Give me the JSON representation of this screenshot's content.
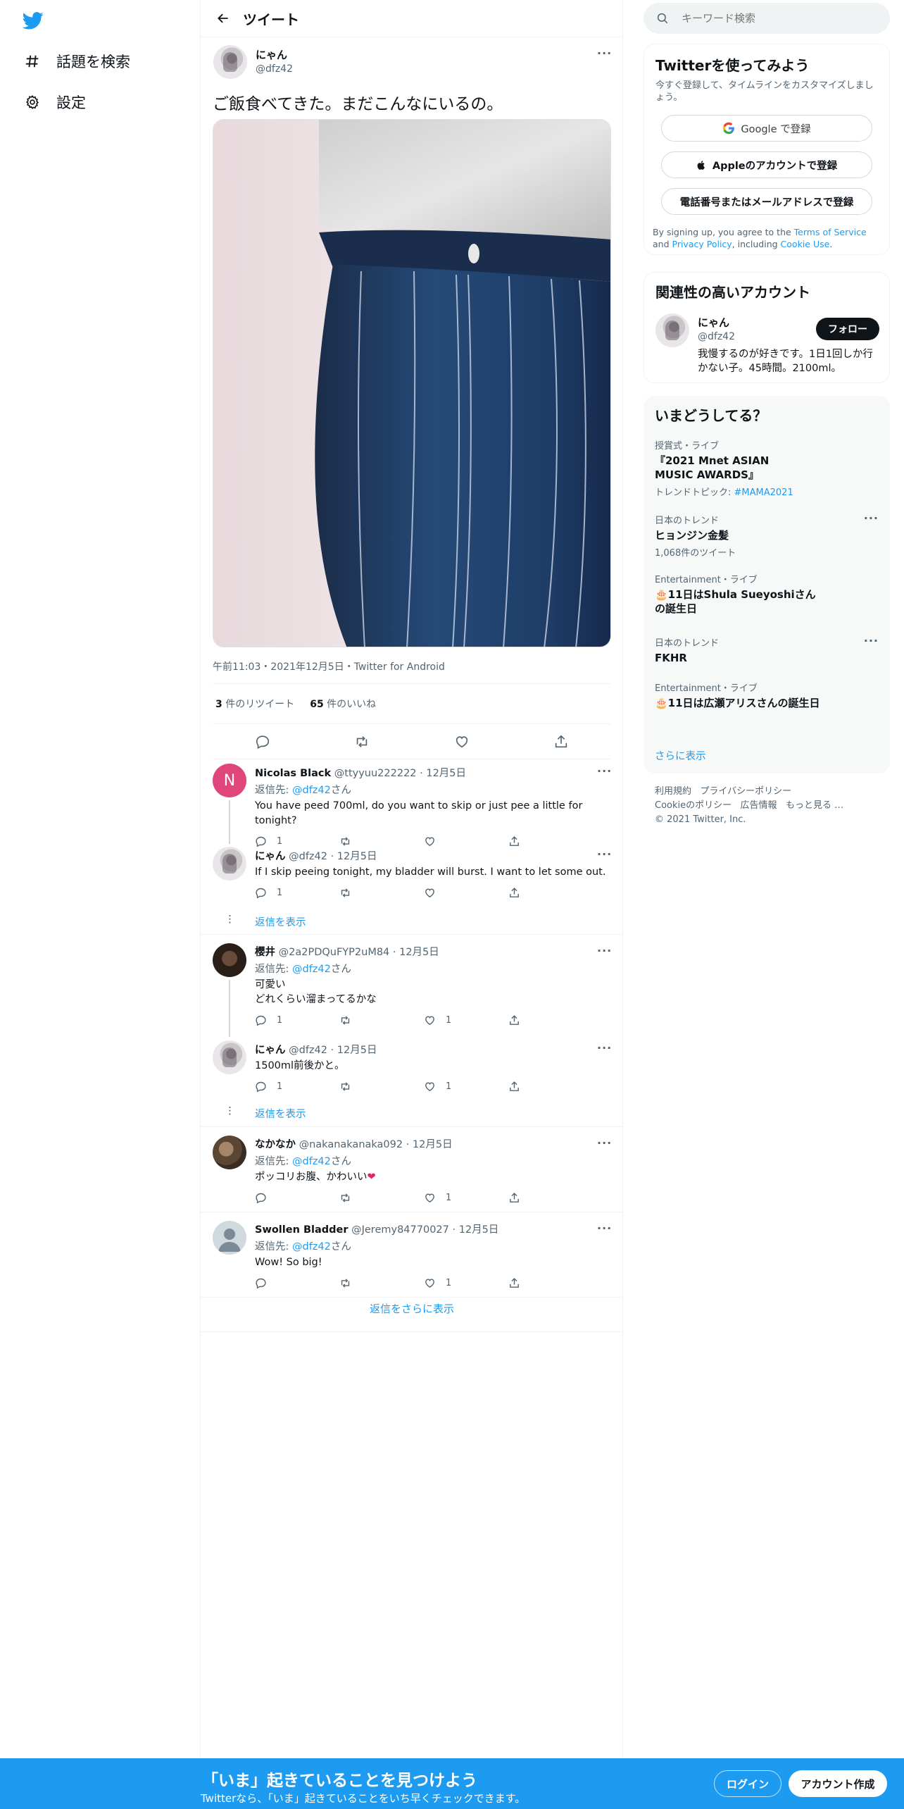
{
  "sidebar": {
    "items": [
      {
        "label": "話題を検索",
        "icon": "hashtag-icon"
      },
      {
        "label": "設定",
        "icon": "gear-icon"
      }
    ]
  },
  "header": {
    "title": "ツイート"
  },
  "tweet": {
    "name": "にゃん",
    "handle": "@dfz42",
    "text": "ご飯食べてきた。まだこんなにいるの。",
    "meta": "午前11:03・2021年12月5日・Twitter for Android",
    "retweets_count": "3",
    "retweets_label": " 件のリツイート",
    "likes_count": "65",
    "likes_label": " 件のいいね"
  },
  "replies": [
    {
      "name": "Nicolas Black",
      "handle": "@ttyyuu222222 · 12月5日",
      "reply_to_prefix": "返信先: ",
      "reply_to": "@dfz42",
      "reply_to_suffix": "さん",
      "text": "You have peed 700ml, do you want to skip or just pee a little for tonight?",
      "replies": "1",
      "likes": ""
    },
    {
      "name": "にゃん",
      "handle": "@dfz42 · 12月5日",
      "text": "If I skip peeing tonight, my bladder will burst. I want to let some out.",
      "replies": "1",
      "likes": ""
    },
    {
      "name": "櫻井",
      "handle": "@2a2PDQuFYP2uM84 · 12月5日",
      "reply_to_prefix": "返信先: ",
      "reply_to": "@dfz42",
      "reply_to_suffix": "さん",
      "text1": "可愛い",
      "text2": "どれくらい溜まってるかな",
      "replies": "1",
      "likes": "1"
    },
    {
      "name": "にゃん",
      "handle": "@dfz42 · 12月5日",
      "text": "1500ml前後かと。",
      "replies": "1",
      "likes": "1"
    },
    {
      "name": "なかなか",
      "handle": "@nakanakanaka092 · 12月5日",
      "reply_to_prefix": "返信先: ",
      "reply_to": "@dfz42",
      "reply_to_suffix": "さん",
      "text": "ポッコリお腹、かわいい",
      "heart": "❤",
      "replies": "",
      "likes": "1"
    },
    {
      "name": "Swollen Bladder",
      "handle": "@Jeremy84770027 · 12月5日",
      "reply_to_prefix": "返信先: ",
      "reply_to": "@dfz42",
      "reply_to_suffix": "さん",
      "text": "Wow! So big!",
      "replies": "",
      "likes": "1"
    }
  ],
  "show_replies": "返信を表示",
  "show_more_replies": "返信をさらに表示",
  "right": {
    "search_placeholder": "キーワード検索",
    "signup": {
      "title": "Twitterを使ってみよう",
      "subtitle": "今すぐ登録して、タイムラインをカスタマイズしましょう。",
      "google": "Google で登録",
      "apple": "Appleのアカウントで登録",
      "phone": "電話番号またはメールアドレスで登録",
      "legal_1": "By signing up, you agree to the ",
      "tos": "Terms of Service",
      "legal_2": " and ",
      "privacy": "Privacy Policy",
      "legal_3": ", including ",
      "cookie": "Cookie Use",
      "legal_4": "."
    },
    "related": {
      "title": "関連性の高いアカウント",
      "name": "にゃん",
      "handle": "@dfz42",
      "bio": "我慢するのが好きです。1日1回しか行かない子。45時間。2100ml。",
      "follow": "フォロー"
    },
    "trends": {
      "title": "いまどうしてる？",
      "items": [
        {
          "context": "授賞式・ライブ",
          "title": "『2021 Mnet ASIAN MUSIC AWARDS』",
          "sub_prefix": "トレンドトピック: ",
          "sub_link": "#MAMA2021"
        },
        {
          "context": "日本のトレンド",
          "title": "ヒョンジン金髪",
          "sub": "1,068件のツイート"
        },
        {
          "context": "Entertainment・ライブ",
          "title": "🎂11日はShula Sueyoshiさんの誕生日"
        },
        {
          "context": "日本のトレンド",
          "title": "FKHR"
        },
        {
          "context": "Entertainment・ライブ",
          "title": "🎂11日は広瀬アリスさんの誕生日"
        }
      ],
      "show_more": "さらに表示"
    },
    "footer": {
      "terms": "利用規約",
      "privacy": "プライバシーポリシー",
      "cookie": "Cookieのポリシー",
      "ads": "広告情報",
      "more": "もっと見る …",
      "copyright": "© 2021 Twitter, Inc."
    }
  },
  "banner": {
    "title": "「いま」起きていることを見つけよう",
    "subtitle": "Twitterなら、「いま」起きていることをいち早くチェックできます。",
    "login": "ログイン",
    "signup": "アカウント作成"
  },
  "colors": {
    "accent": "#1d9bf0",
    "heart": "#e0245e"
  }
}
